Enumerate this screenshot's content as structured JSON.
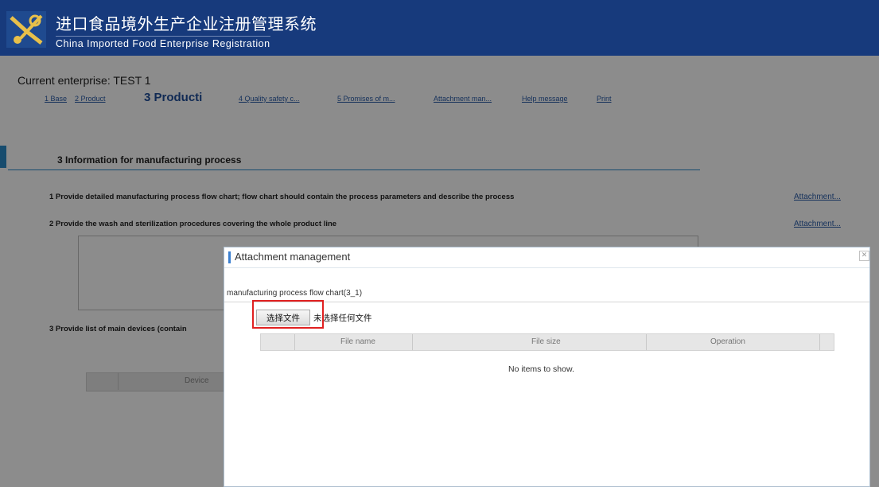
{
  "header": {
    "title_cn": "进口食品境外生产企业注册管理系统",
    "title_en": "China Imported Food Enterprise Registration",
    "logo_icon": "customs-emblem-icon",
    "bg_color": "#173a7c"
  },
  "page": {
    "current_enterprise": "Current enterprise: TEST 1",
    "steps": [
      {
        "label": "1 Base",
        "active": false
      },
      {
        "label": "2 Product",
        "active": false
      },
      {
        "label": "3 Producti",
        "active": true
      },
      {
        "label": "4 Quality safety c...",
        "active": false
      },
      {
        "label": "5 Promises of m...",
        "active": false
      },
      {
        "label": "Attachment man...",
        "active": false
      },
      {
        "label": "Help message",
        "active": false
      },
      {
        "label": "Print",
        "active": false
      }
    ],
    "section_title": "3 Information for manufacturing process",
    "requirements": [
      {
        "text": "1 Provide detailed manufacturing process flow chart; flow chart should contain the process parameters and describe the process",
        "link": "Attachment..."
      },
      {
        "text": "2 Provide the wash and sterilization procedures covering the whole product line",
        "link": "Attachment..."
      },
      {
        "text": "3 Provide list of main devices (contain",
        "link": ""
      }
    ],
    "bg_table_col": "Device"
  },
  "dialog": {
    "title": "Attachment management",
    "close_icon": "close-icon",
    "subtitle": "manufacturing process flow chart(3_1)",
    "choose_file": "选择文件",
    "no_file": "未选择任何文件",
    "columns": [
      "File name",
      "File size",
      "Operation"
    ],
    "empty_message": "No items to show.",
    "highlight_color": "#e02020"
  }
}
